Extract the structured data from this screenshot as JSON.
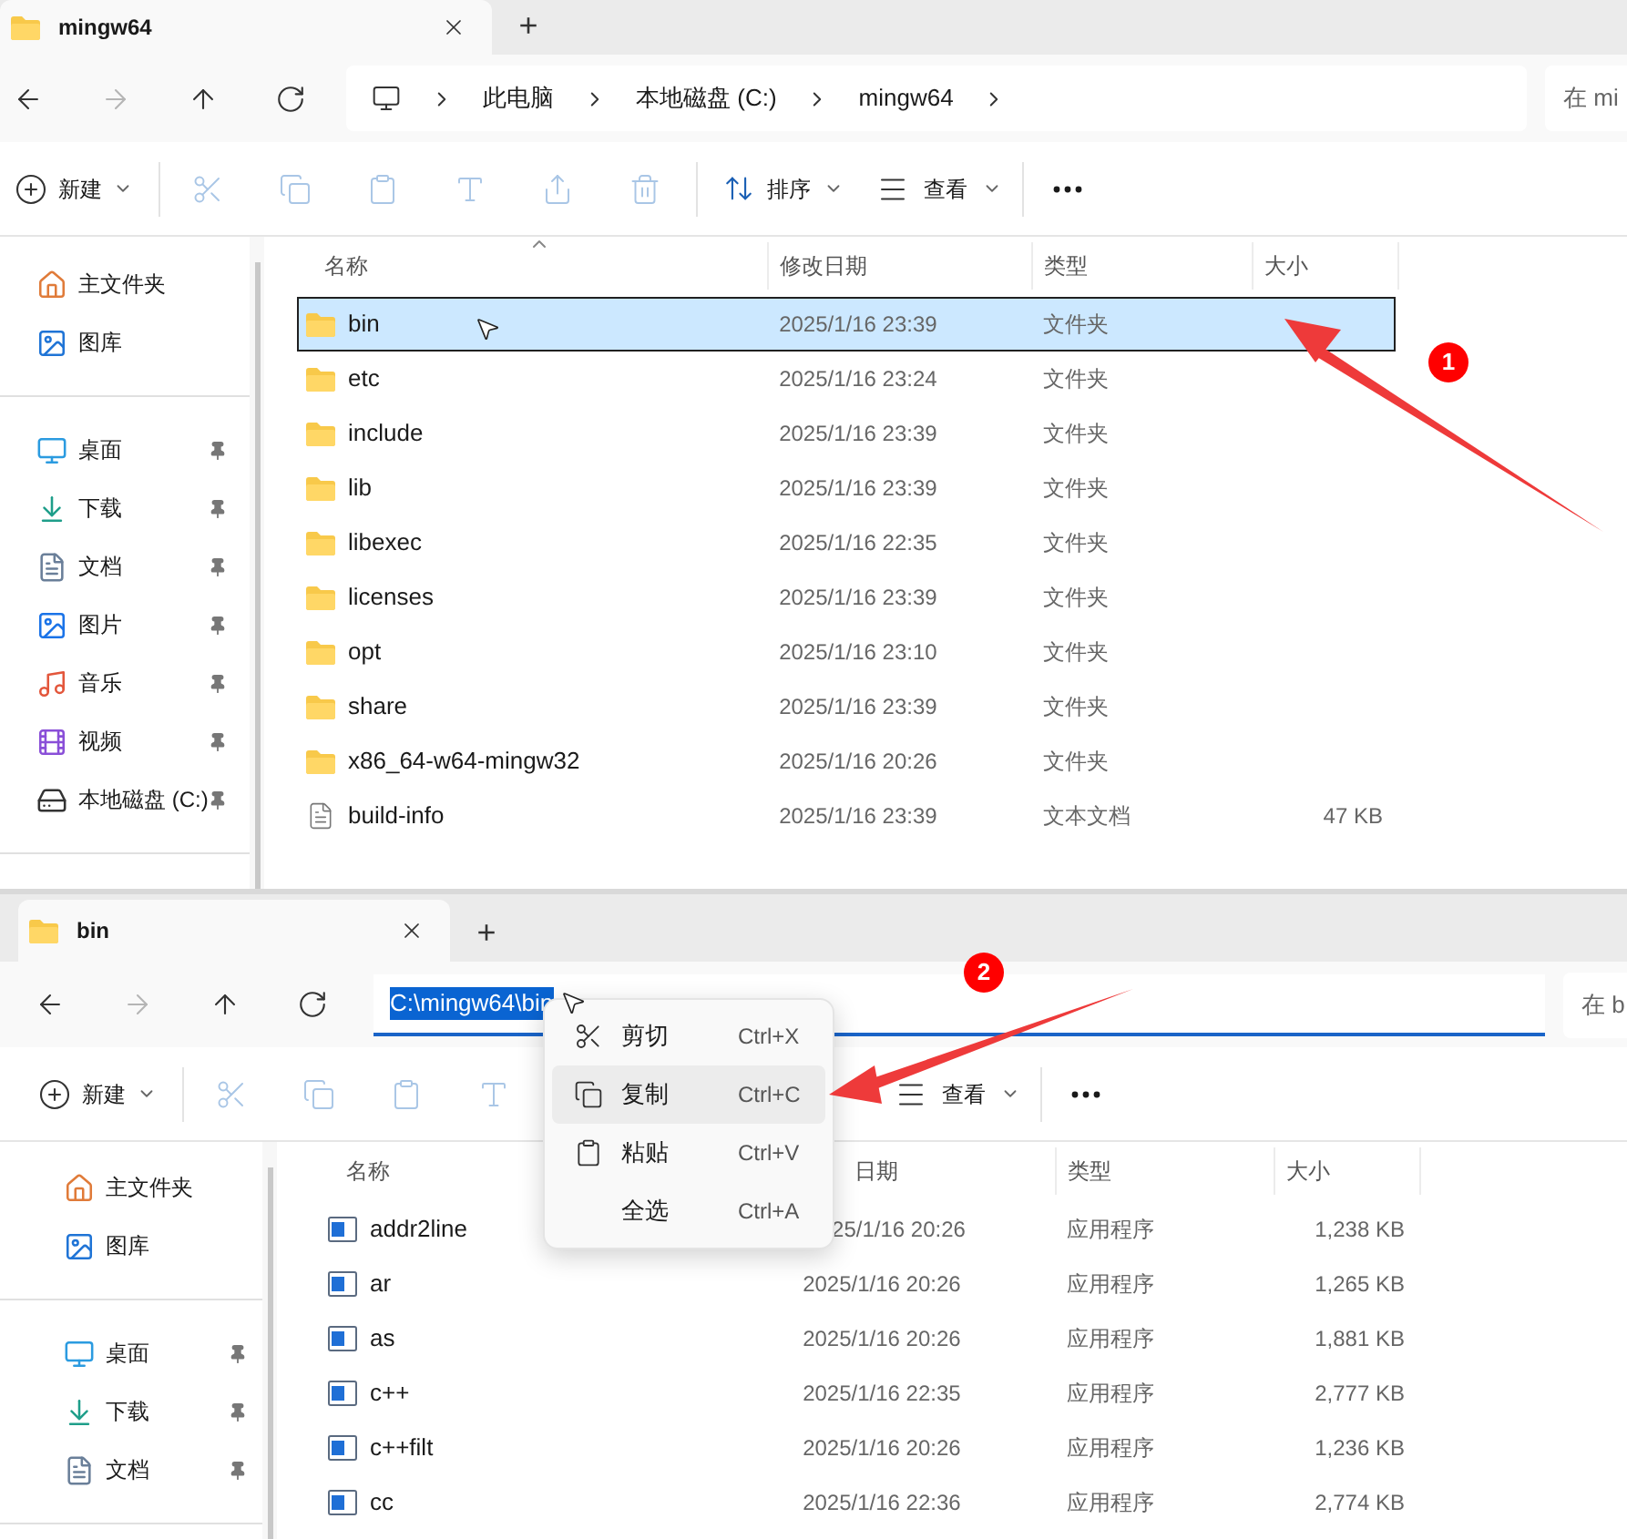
{
  "windows": [
    {
      "tab": {
        "title": "mingw64",
        "selected": true
      },
      "new_tab": "+",
      "nav": [
        {
          "kind": "back",
          "disabled": false
        },
        {
          "kind": "forward",
          "disabled": true
        },
        {
          "kind": "up",
          "disabled": false
        },
        {
          "kind": "refresh",
          "disabled": false
        }
      ],
      "address": {
        "kind": "breadcrumb",
        "crumbs": [
          "此电脑",
          "本地磁盘 (C:)",
          "mingw64"
        ]
      },
      "search": {
        "placeholder": "在 mi"
      },
      "toolbar": [
        {
          "kind": "new",
          "label": "新建",
          "disabled": false
        },
        {
          "kind": "cut",
          "disabled": true
        },
        {
          "kind": "copy",
          "disabled": true
        },
        {
          "kind": "paste",
          "disabled": true
        },
        {
          "kind": "rename",
          "disabled": true
        },
        {
          "kind": "share",
          "disabled": true
        },
        {
          "kind": "delete",
          "disabled": true
        },
        {
          "kind": "sort",
          "label": "排序",
          "disabled": false
        },
        {
          "kind": "view",
          "label": "查看",
          "disabled": false
        },
        {
          "kind": "more",
          "disabled": false
        }
      ],
      "sidebar": [
        {
          "items": [
            {
              "label": "主文件夹",
              "kind": "home",
              "pinned": false
            },
            {
              "label": "图库",
              "kind": "gallery",
              "pinned": false
            }
          ]
        },
        {
          "items": [
            {
              "label": "桌面",
              "kind": "desktop",
              "pinned": true
            },
            {
              "label": "下载",
              "kind": "download",
              "pinned": true
            },
            {
              "label": "文档",
              "kind": "documents",
              "pinned": true
            },
            {
              "label": "图片",
              "kind": "pictures",
              "pinned": true
            },
            {
              "label": "音乐",
              "kind": "music",
              "pinned": true
            },
            {
              "label": "视频",
              "kind": "videos",
              "pinned": true
            },
            {
              "label": "本地磁盘 (C:)",
              "kind": "drive",
              "pinned": true
            }
          ]
        }
      ],
      "columns": [
        {
          "label": "名称",
          "sorted": true
        },
        {
          "label": "修改日期"
        },
        {
          "label": "类型"
        },
        {
          "label": "大小"
        }
      ],
      "rows": [
        {
          "kind": "folder",
          "name": "bin",
          "date": "2025/1/16 23:39",
          "type": "文件夹",
          "selected": true,
          "clipped": false
        },
        {
          "kind": "folder",
          "name": "etc",
          "date": "2025/1/16 23:24",
          "type": "文件夹",
          "selected": false,
          "clipped": false
        },
        {
          "kind": "folder",
          "name": "include",
          "date": "2025/1/16 23:39",
          "type": "文件夹",
          "selected": false,
          "clipped": false
        },
        {
          "kind": "folder",
          "name": "lib",
          "date": "2025/1/16 23:39",
          "type": "文件夹",
          "selected": false,
          "clipped": false
        },
        {
          "kind": "folder",
          "name": "libexec",
          "date": "2025/1/16 22:35",
          "type": "文件夹",
          "selected": false,
          "clipped": false
        },
        {
          "kind": "folder",
          "name": "licenses",
          "date": "2025/1/16 23:39",
          "type": "文件夹",
          "selected": false,
          "clipped": false
        },
        {
          "kind": "folder",
          "name": "opt",
          "date": "2025/1/16 23:10",
          "type": "文件夹",
          "selected": false,
          "clipped": false
        },
        {
          "kind": "folder",
          "name": "share",
          "date": "2025/1/16 23:39",
          "type": "文件夹",
          "selected": false,
          "clipped": false
        },
        {
          "kind": "folder",
          "name": "x86_64-w64-mingw32",
          "date": "2025/1/16 20:26",
          "type": "文件夹",
          "selected": false,
          "clipped": false
        },
        {
          "kind": "file",
          "name": "build-info",
          "date": "2025/1/16 23:39",
          "type": "文本文档",
          "size": "47 KB",
          "selected": false,
          "clipped": false
        }
      ]
    },
    {
      "tab": {
        "title": "bin",
        "selected": true
      },
      "new_tab": "+",
      "nav": [
        {
          "kind": "back",
          "disabled": false
        },
        {
          "kind": "forward",
          "disabled": true
        },
        {
          "kind": "up",
          "disabled": false
        },
        {
          "kind": "refresh",
          "disabled": false
        }
      ],
      "address": {
        "kind": "editing",
        "value": "C:\\mingw64\\bin",
        "selected": true
      },
      "search": {
        "placeholder": "在 b"
      },
      "toolbar": [
        {
          "kind": "new",
          "label": "新建",
          "disabled": false
        },
        {
          "kind": "cut",
          "disabled": true
        },
        {
          "kind": "copy",
          "disabled": true
        },
        {
          "kind": "paste",
          "disabled": true
        },
        {
          "kind": "rename",
          "disabled": true
        },
        {
          "kind": "view",
          "label": "查看",
          "disabled": false
        },
        {
          "kind": "more",
          "disabled": false
        }
      ],
      "sidebar": [
        {
          "items": [
            {
              "label": "主文件夹",
              "kind": "home",
              "pinned": false
            },
            {
              "label": "图库",
              "kind": "gallery",
              "pinned": false
            }
          ]
        },
        {
          "items": [
            {
              "label": "桌面",
              "kind": "desktop",
              "pinned": true
            },
            {
              "label": "下载",
              "kind": "download",
              "pinned": true
            },
            {
              "label": "文档",
              "kind": "documents",
              "pinned": true
            }
          ]
        }
      ],
      "columns": [
        {
          "label": "名称"
        },
        {
          "label": "日期",
          "clipped": true
        },
        {
          "label": "类型"
        },
        {
          "label": "大小"
        }
      ],
      "rows": [
        {
          "kind": "app",
          "name": "addr2line",
          "date": "25/1/16 20:26",
          "type": "应用程序",
          "size": "1,238 KB",
          "selected": false,
          "clipped": true
        },
        {
          "kind": "app",
          "name": "ar",
          "date": "2025/1/16 20:26",
          "type": "应用程序",
          "size": "1,265 KB",
          "selected": false,
          "clipped": false
        },
        {
          "kind": "app",
          "name": "as",
          "date": "2025/1/16 20:26",
          "type": "应用程序",
          "size": "1,881 KB",
          "selected": false,
          "clipped": false
        },
        {
          "kind": "app",
          "name": "c++",
          "date": "2025/1/16 22:35",
          "type": "应用程序",
          "size": "2,777 KB",
          "selected": false,
          "clipped": false
        },
        {
          "kind": "app",
          "name": "c++filt",
          "date": "2025/1/16 20:26",
          "type": "应用程序",
          "size": "1,236 KB",
          "selected": false,
          "clipped": false
        },
        {
          "kind": "app",
          "name": "cc",
          "date": "2025/1/16 22:36",
          "type": "应用程序",
          "size": "2,774 KB",
          "selected": false,
          "clipped": false
        }
      ]
    }
  ],
  "context_menu": {
    "items": [
      {
        "kind": "cut",
        "label": "剪切",
        "shortcut": "Ctrl+X",
        "selected": false
      },
      {
        "kind": "copy",
        "label": "复制",
        "shortcut": "Ctrl+C",
        "selected": true
      },
      {
        "kind": "paste",
        "label": "粘贴",
        "shortcut": "Ctrl+V",
        "selected": false
      },
      {
        "kind": "select-all",
        "label": "全选",
        "shortcut": "Ctrl+A",
        "selected": false
      }
    ]
  },
  "annotations": [
    {
      "label": "1"
    },
    {
      "label": "2"
    }
  ]
}
